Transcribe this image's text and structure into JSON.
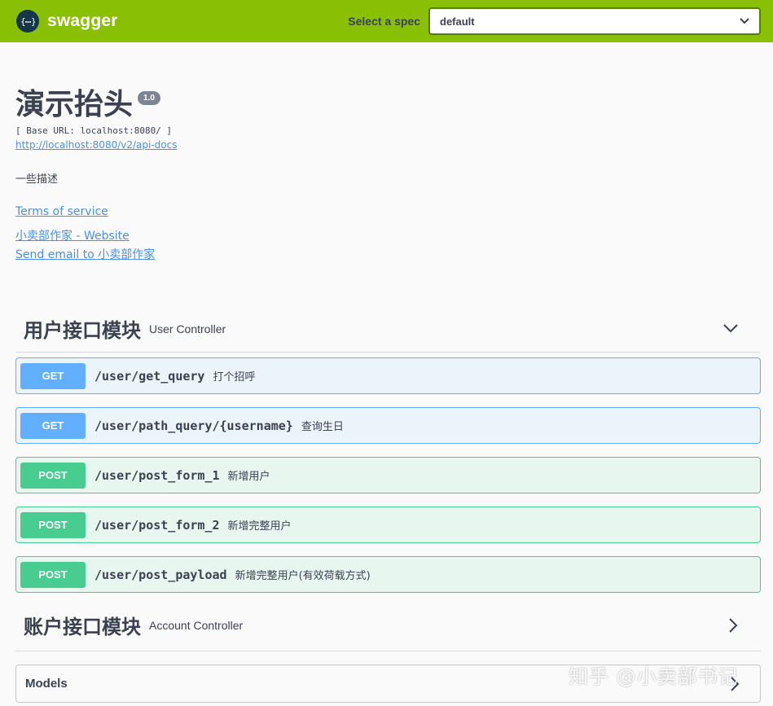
{
  "topbar": {
    "brand": "swagger",
    "spec_label": "Select a spec",
    "spec_value": "default",
    "brand_color": "#89bf04"
  },
  "info": {
    "title": "演示抬头",
    "version": "1.0",
    "base_url": "[ Base URL: localhost:8080/ ]",
    "api_docs_link": "http://localhost:8080/v2/api-docs",
    "description": "一些描述",
    "terms": "Terms of service",
    "contact_website": "小卖部作家 - Website",
    "contact_email": "Send email to 小卖部作家"
  },
  "tags": [
    {
      "name": "用户接口模块",
      "description": "User Controller",
      "expanded": true,
      "operations": [
        {
          "method": "GET",
          "path": "/user/get_query",
          "summary": "打个招呼"
        },
        {
          "method": "GET",
          "path": "/user/path_query/{username}",
          "summary": "查询生日"
        },
        {
          "method": "POST",
          "path": "/user/post_form_1",
          "summary": "新增用户"
        },
        {
          "method": "POST",
          "path": "/user/post_form_2",
          "summary": "新增完整用户"
        },
        {
          "method": "POST",
          "path": "/user/post_payload",
          "summary": "新增完整用户(有效荷载方式)"
        }
      ]
    },
    {
      "name": "账户接口模块",
      "description": "Account Controller",
      "expanded": false
    }
  ],
  "models": {
    "title": "Models"
  },
  "watermark": "知乎 @小卖部书记",
  "colors": {
    "get": "#61affe",
    "post": "#49cc90",
    "text": "#3b4151",
    "link": "#4990e2"
  },
  "icons": {
    "logo": "swagger-braces-icon",
    "select": "chevron-down-icon",
    "expand": "chevron-down-icon",
    "collapse": "chevron-right-icon"
  }
}
